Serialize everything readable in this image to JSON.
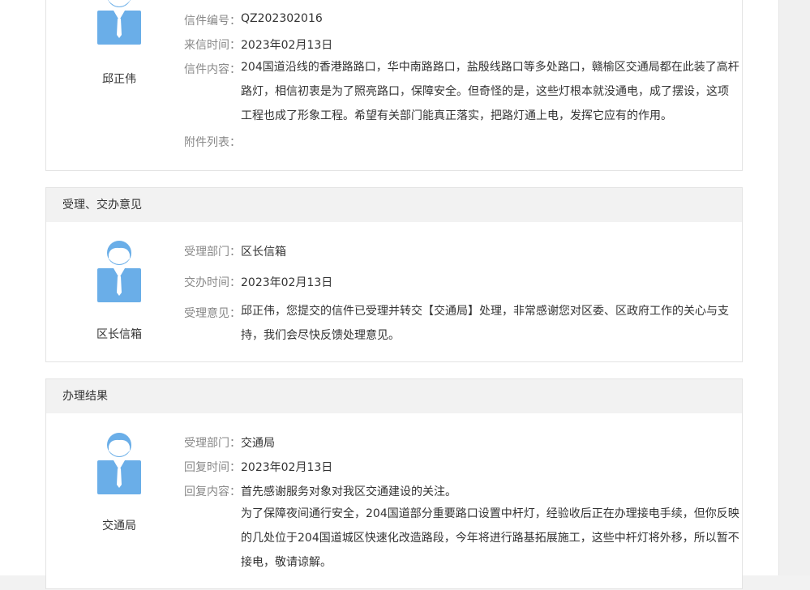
{
  "letter": {
    "sender": "邱正伟",
    "fields": {
      "number": {
        "label": "信件编号：",
        "value": "QZ202302016"
      },
      "time": {
        "label": "来信时间：",
        "value": "2023年02月13日"
      },
      "content": {
        "label": "信件内容：",
        "lines": [
          "204国道沿线的香港路路口，华中南路路口，盐殷线路口等多处路口，赣榆区交通局都在此装了高杆",
          "路灯，相信初衷是为了照亮路口，保障安全。但奇怪的是，这些灯根本就没通电，成了摆设，这项",
          "工程也成了形象工程。希望有关部门能真正落实，把路灯通上电，发挥它应有的作用。"
        ]
      },
      "attachments": {
        "label": "附件列表：",
        "value": ""
      }
    }
  },
  "acceptance": {
    "header": "受理、交办意见",
    "sender": "区长信箱",
    "fields": {
      "dept": {
        "label": "受理部门：",
        "value": "区长信箱"
      },
      "time": {
        "label": "交办时间：",
        "value": "2023年02月13日"
      },
      "opinion": {
        "label": "受理意见：",
        "lines": [
          "邱正伟，您提交的信件已受理并转交【交通局】处理，非常感谢您对区委、区政府工作的关心与支",
          "持，我们会尽快反馈处理意见。"
        ]
      }
    }
  },
  "result": {
    "header": "办理结果",
    "sender": "交通局",
    "fields": {
      "dept": {
        "label": "受理部门：",
        "value": "交通局"
      },
      "time": {
        "label": "回复时间：",
        "value": "2023年02月13日"
      },
      "reply": {
        "label": "回复内容：",
        "first_line": "首先感谢服务对象对我区交通建设的关注。",
        "lines": [
          "为了保障夜间通行安全，204国道部分重要路口设置中杆灯，经验收后正在办理接电手续，但你反映",
          "的几处位于204国道城区快速化改造路段，今年将进行路基拓展施工，这些中杆灯将外移，所以暂不",
          "接电，敬请谅解。"
        ]
      }
    }
  },
  "colors": {
    "avatar_blue": "#6aaee8",
    "header_bg": "#f2f2f2",
    "label_gray": "#888888"
  },
  "icons": {
    "avatar": "user-avatar-icon"
  }
}
